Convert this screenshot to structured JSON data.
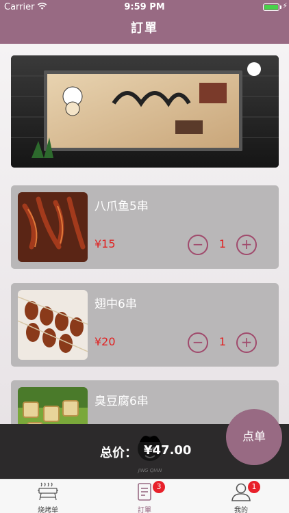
{
  "status": {
    "carrier": "Carrier",
    "time": "9:59 PM"
  },
  "nav": {
    "title": "訂單"
  },
  "colors": {
    "brand": "#986a83",
    "price": "#e02020",
    "dark_bar": "#2c2a2b"
  },
  "items": [
    {
      "name": "八爪鱼5串",
      "price": "¥15",
      "qty": "1"
    },
    {
      "name": "翅中6串",
      "price": "¥20",
      "qty": "1"
    },
    {
      "name": "臭豆腐6串",
      "price": "",
      "qty": ""
    }
  ],
  "totalbar": {
    "label": "总价：",
    "value": "¥47.00"
  },
  "order_button": {
    "label": "点单"
  },
  "tabs": [
    {
      "label": "烧烤单",
      "icon": "grill-icon",
      "badge": ""
    },
    {
      "label": "訂單",
      "icon": "order-list-icon",
      "badge": "3"
    },
    {
      "label": "我的",
      "icon": "user-icon",
      "badge": "1"
    }
  ]
}
